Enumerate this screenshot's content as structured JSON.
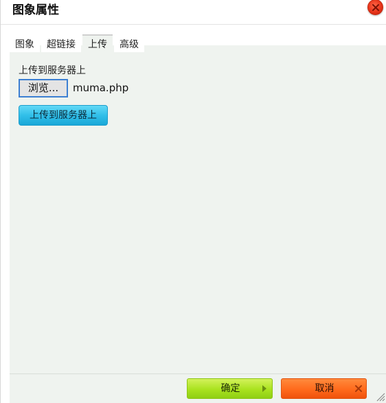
{
  "window": {
    "title": "图象属性",
    "close_icon": "close-icon"
  },
  "tabs": [
    {
      "label": "图象",
      "active": false
    },
    {
      "label": "超链接",
      "active": false
    },
    {
      "label": "上传",
      "active": true
    },
    {
      "label": "高级",
      "active": false
    }
  ],
  "upload": {
    "label": "上传到服务器上",
    "browse_label": "浏览...",
    "filename": "muma.php",
    "submit_label": "上传到服务器上"
  },
  "footer": {
    "ok_label": "确定",
    "cancel_label": "取消"
  },
  "colors": {
    "panel_bg": "#eff3ef",
    "ok_green": "#a9e21f",
    "cancel_orange": "#ff6a1c",
    "upload_cyan": "#31bfe9",
    "close_red": "#e8341a"
  }
}
